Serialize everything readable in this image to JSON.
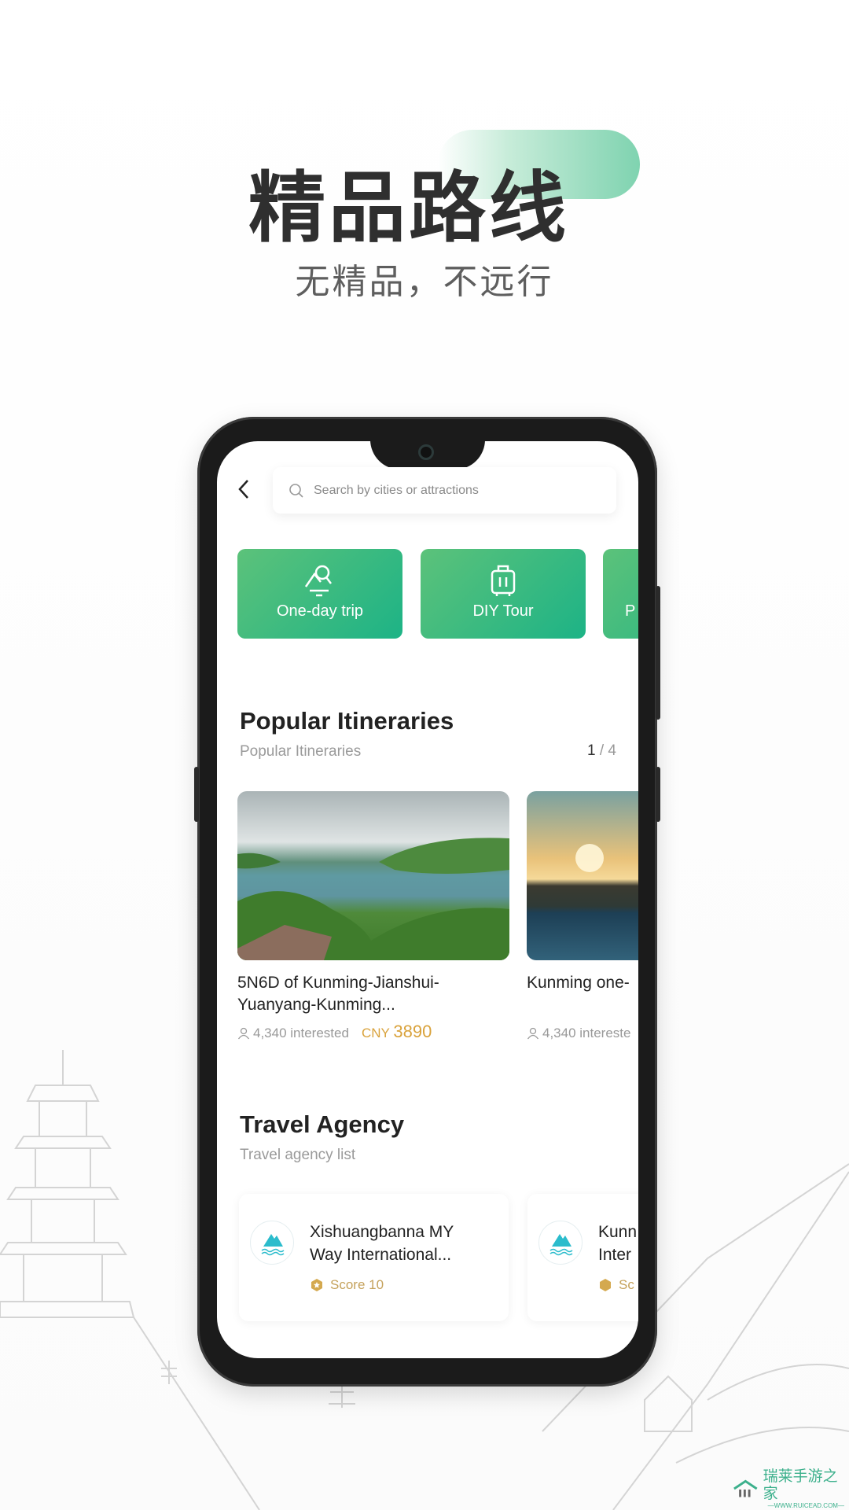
{
  "hero": {
    "title": "精品路线",
    "subtitle": "无精品，不远行",
    "accent": "#7fd3b0"
  },
  "search": {
    "placeholder": "Search by cities or attractions"
  },
  "categories": [
    {
      "label": "One-day trip",
      "icon": "mountain-search-icon"
    },
    {
      "label": "DIY Tour",
      "icon": "suitcase-icon"
    },
    {
      "label": "P",
      "icon": ""
    }
  ],
  "popular": {
    "title": "Popular Itineraries",
    "subtitle": "Popular Itineraries",
    "pager_current": "1",
    "pager_sep": "/",
    "pager_total": "4",
    "items": [
      {
        "title_line1": "5N6D of Kunming-Jianshui-",
        "title_line2": "Yuanyang-Kunming...",
        "interested": "4,340 interested",
        "currency": "CNY",
        "price": "3890"
      },
      {
        "title_line1": "Kunming one-",
        "interested": "4,340 intereste"
      }
    ]
  },
  "agency": {
    "title": "Travel Agency",
    "subtitle": "Travel agency list",
    "items": [
      {
        "name_line1": "Xishuangbanna MY",
        "name_line2": "Way International...",
        "score": "Score 10"
      },
      {
        "name_line1": "Kunn",
        "name_line2": "Inter",
        "score": "Sc"
      }
    ]
  },
  "colors": {
    "brand_green": "#1db386",
    "price": "#d9a23b",
    "score": "#c5a25c"
  },
  "watermark": {
    "name": "瑞莱手游之家",
    "url": "—WWW.RUICEAD.COM—"
  }
}
